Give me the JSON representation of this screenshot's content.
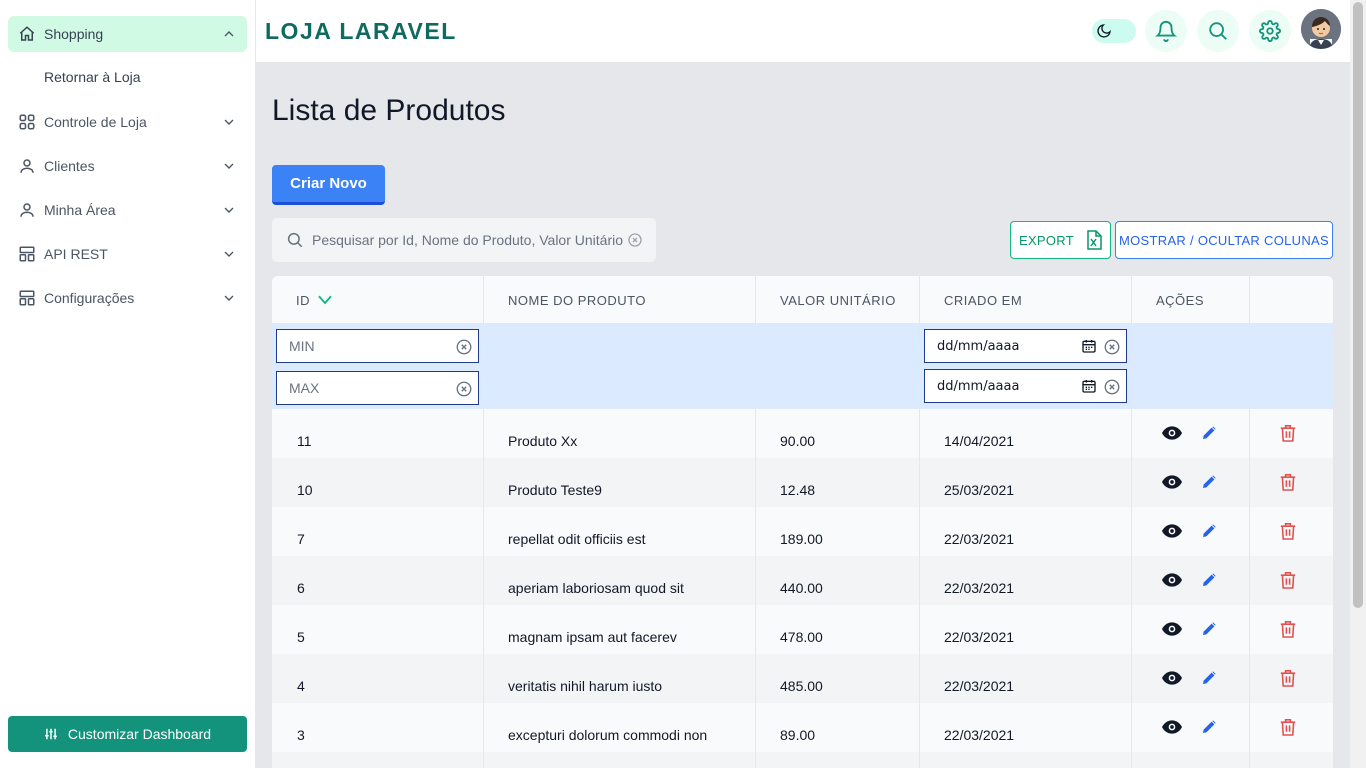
{
  "sidebar": {
    "items": [
      {
        "label": "Shopping"
      },
      {
        "label": "Controle de Loja"
      },
      {
        "label": "Clientes"
      },
      {
        "label": "Minha Área"
      },
      {
        "label": "API REST"
      },
      {
        "label": "Configurações"
      }
    ],
    "subitem": "Retornar à Loja",
    "customize_label": "Customizar Dashboard"
  },
  "header": {
    "brand": "LOJA LARAVEL"
  },
  "main": {
    "title": "Lista de Produtos",
    "create_label": "Criar Novo",
    "search_placeholder": "Pesquisar por Id, Nome do Produto, Valor Unitário",
    "export_label": "EXPORT",
    "columns_label": "MOSTRAR / OCULTAR COLUNAS"
  },
  "table": {
    "headers": [
      "ID",
      "NOME DO PRODUTO",
      "VALOR UNITÁRIO",
      "CRIADO EM",
      "AÇÕES"
    ],
    "filters": {
      "min_placeholder": "MIN",
      "max_placeholder": "MAX",
      "date_from": "dd/mm/aaaa",
      "date_to": "dd/mm/aaaa"
    },
    "rows": [
      {
        "id": "11",
        "name": "Produto Xx",
        "price": "90.00",
        "created": "14/04/2021"
      },
      {
        "id": "10",
        "name": "Produto Teste9",
        "price": "12.48",
        "created": "25/03/2021"
      },
      {
        "id": "7",
        "name": "repellat odit officiis est",
        "price": "189.00",
        "created": "22/03/2021"
      },
      {
        "id": "6",
        "name": "aperiam laboriosam quod sit",
        "price": "440.00",
        "created": "22/03/2021"
      },
      {
        "id": "5",
        "name": "magnam ipsam aut facerev",
        "price": "478.00",
        "created": "22/03/2021"
      },
      {
        "id": "4",
        "name": "veritatis nihil harum iusto",
        "price": "485.00",
        "created": "22/03/2021"
      },
      {
        "id": "3",
        "name": "excepturi dolorum commodi non",
        "price": "89.00",
        "created": "22/03/2021"
      }
    ]
  },
  "icons": {
    "home": "home-icon",
    "grid": "grid-icon",
    "user": "user-icon",
    "api": "layout-icon",
    "settings": "layout-icon",
    "moon": "moon-icon",
    "bell": "bell-icon",
    "search": "search-icon",
    "gear": "gear-icon",
    "sliders": "sliders-icon",
    "excel": "excel-icon",
    "view": "eye-icon",
    "edit": "pencil-icon",
    "delete": "trash-icon"
  },
  "colors": {
    "primary": "#14937c",
    "brand": "#0f6b5f",
    "accent_blue": "#3b82f6",
    "delete": "#e05252",
    "active_nav_bg": "#d1fae5"
  }
}
